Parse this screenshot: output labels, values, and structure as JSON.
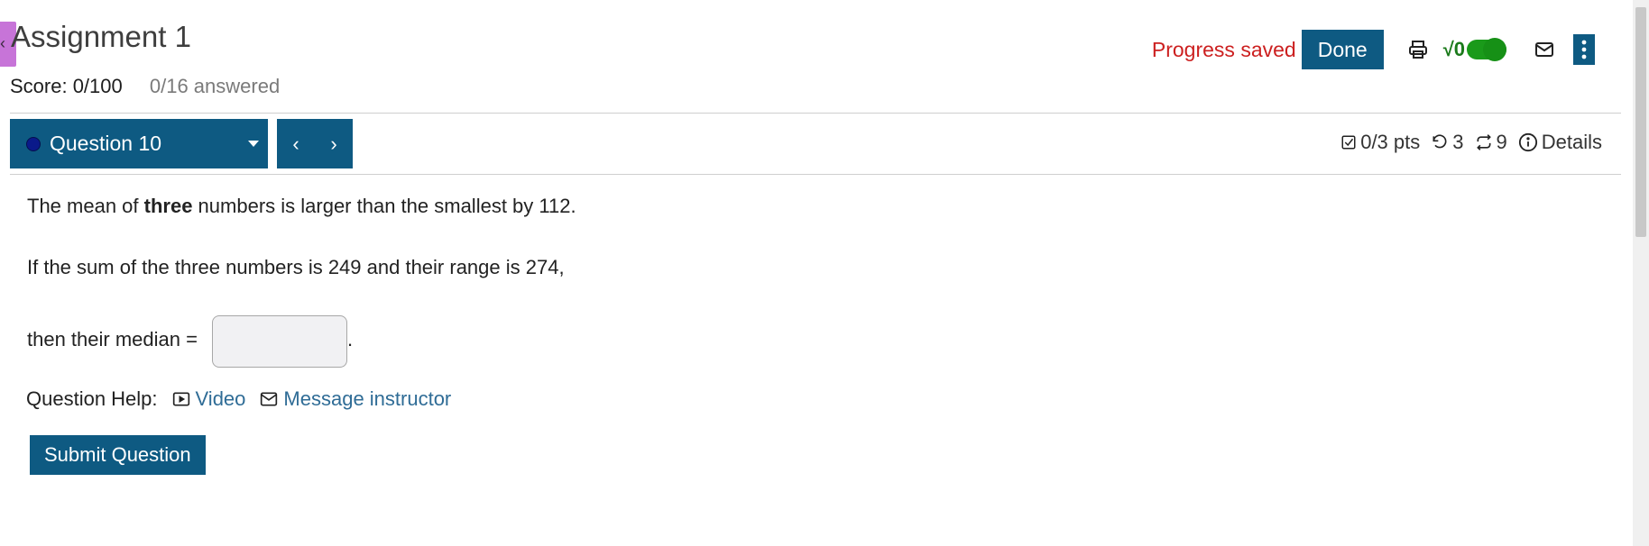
{
  "header": {
    "title": "Assignment 1",
    "score": "Score: 0/100",
    "answered": "0/16 answered",
    "progress_status": "Progress saved",
    "done_label": "Done",
    "math_toggle_label": "√0",
    "math_toggle_on": true
  },
  "question_bar": {
    "selected_question": "Question 10",
    "prev_symbol": "‹",
    "next_symbol": "›",
    "points": "0/3 pts",
    "retries": "3",
    "attempts": "9",
    "details_label": "Details"
  },
  "question": {
    "line1_pre": "The mean of ",
    "line1_bold": "three",
    "line1_post": " numbers is larger than the smallest by 112.",
    "line2": "If the sum of the three numbers is 249 and their range is 274,",
    "line3": "then their median =",
    "answer_value": "",
    "period": "."
  },
  "help": {
    "label": "Question Help:",
    "video_label": "Video",
    "message_label": "Message instructor"
  },
  "submit_label": "Submit Question",
  "colors": {
    "primary": "#0e5a82",
    "progress_red": "#cc1f1f",
    "link": "#2f6c96",
    "toggle_green": "#1a9a1a",
    "side_tab": "#c774d8"
  }
}
